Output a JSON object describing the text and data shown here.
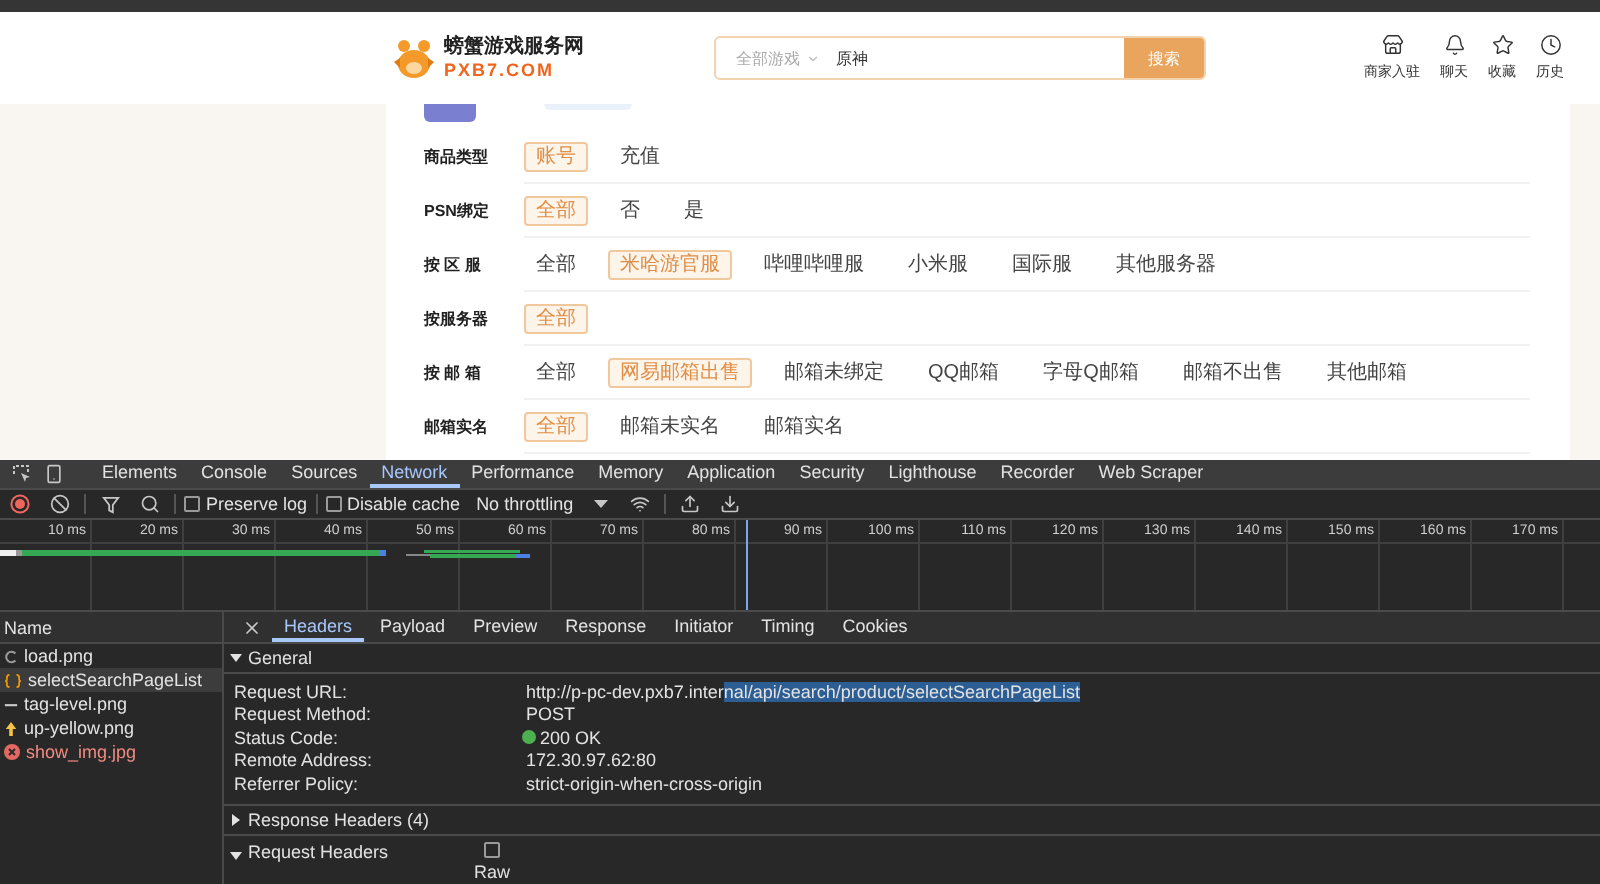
{
  "header": {
    "logo": {
      "title": "螃蟹游戏服务网",
      "domain": "PXB7.COM"
    },
    "search": {
      "category": "全部游戏",
      "value": "原神",
      "button": "搜索"
    },
    "nav": [
      {
        "label": "商家入驻",
        "kind": "store"
      },
      {
        "label": "聊天",
        "kind": "bell"
      },
      {
        "label": "收藏",
        "kind": "star"
      },
      {
        "label": "历史",
        "kind": "clock"
      }
    ]
  },
  "filters": [
    {
      "label": "商品类型",
      "options": [
        {
          "label": "账号",
          "selected": true
        },
        {
          "label": "充值",
          "selected": false
        }
      ]
    },
    {
      "label": "PSN绑定",
      "options": [
        {
          "label": "全部",
          "selected": true
        },
        {
          "label": "否",
          "selected": false
        },
        {
          "label": "是",
          "selected": false
        }
      ]
    },
    {
      "label": "按 区 服",
      "options": [
        {
          "label": "全部",
          "selected": false
        },
        {
          "label": "米哈游官服",
          "selected": true
        },
        {
          "label": "哔哩哔哩服",
          "selected": false
        },
        {
          "label": "小米服",
          "selected": false
        },
        {
          "label": "国际服",
          "selected": false
        },
        {
          "label": "其他服务器",
          "selected": false
        }
      ]
    },
    {
      "label": "按服务器",
      "options": [
        {
          "label": "全部",
          "selected": true
        }
      ]
    },
    {
      "label": "按 邮 箱",
      "options": [
        {
          "label": "全部",
          "selected": false
        },
        {
          "label": "网易邮箱出售",
          "selected": true
        },
        {
          "label": "邮箱未绑定",
          "selected": false
        },
        {
          "label": "QQ邮箱",
          "selected": false
        },
        {
          "label": "字母Q邮箱",
          "selected": false
        },
        {
          "label": "邮箱不出售",
          "selected": false
        },
        {
          "label": "其他邮箱",
          "selected": false
        }
      ]
    },
    {
      "label": "邮箱实名",
      "options": [
        {
          "label": "全部",
          "selected": true
        },
        {
          "label": "邮箱未实名",
          "selected": false
        },
        {
          "label": "邮箱实名",
          "selected": false
        }
      ]
    }
  ],
  "devtools": {
    "tabs": [
      {
        "label": "Elements",
        "selected": false
      },
      {
        "label": "Console",
        "selected": false
      },
      {
        "label": "Sources",
        "selected": false
      },
      {
        "label": "Network",
        "selected": true
      },
      {
        "label": "Performance",
        "selected": false
      },
      {
        "label": "Memory",
        "selected": false
      },
      {
        "label": "Application",
        "selected": false
      },
      {
        "label": "Security",
        "selected": false
      },
      {
        "label": "Lighthouse",
        "selected": false
      },
      {
        "label": "Recorder",
        "selected": false
      },
      {
        "label": "Web Scraper",
        "selected": false
      }
    ],
    "toolbar": {
      "preserve_log": {
        "label": "Preserve log",
        "checked": false
      },
      "disable_cache": {
        "label": "Disable cache",
        "checked": false
      },
      "throttling": "No throttling"
    },
    "timeline_ticks": [
      "10 ms",
      "20 ms",
      "30 ms",
      "40 ms",
      "50 ms",
      "60 ms",
      "70 ms",
      "80 ms",
      "90 ms",
      "100 ms",
      "110 ms",
      "120 ms",
      "130 ms",
      "140 ms",
      "150 ms",
      "160 ms",
      "170 ms"
    ],
    "requests": {
      "column": "Name",
      "items": [
        {
          "name": "load.png",
          "kind": "pending",
          "selected": false
        },
        {
          "name": "selectSearchPageList",
          "kind": "fetch",
          "selected": true
        },
        {
          "name": "tag-level.png",
          "kind": "image",
          "selected": false
        },
        {
          "name": "up-yellow.png",
          "kind": "arrow",
          "selected": false
        },
        {
          "name": "show_img.jpg",
          "kind": "error",
          "selected": false
        }
      ]
    },
    "detail_tabs": [
      {
        "label": "Headers",
        "selected": true
      },
      {
        "label": "Payload",
        "selected": false
      },
      {
        "label": "Preview",
        "selected": false
      },
      {
        "label": "Response",
        "selected": false
      },
      {
        "label": "Initiator",
        "selected": false
      },
      {
        "label": "Timing",
        "selected": false
      },
      {
        "label": "Cookies",
        "selected": false
      }
    ],
    "general": {
      "title": "General",
      "expanded": true,
      "rows": [
        {
          "label": "Request URL:",
          "kind": "url",
          "value_parts": [
            {
              "text": "http://p-pc-dev.pxb7.inter",
              "selected": false
            },
            {
              "text": "nal/api/search/product/selectSearchPageList",
              "selected": true
            }
          ]
        },
        {
          "label": "Request Method:",
          "kind": "text",
          "value_parts": [
            {
              "text": "POST",
              "selected": false
            }
          ]
        },
        {
          "label": "Status Code:",
          "kind": "status",
          "value_parts": [
            {
              "text": "200 OK",
              "selected": false
            }
          ]
        },
        {
          "label": "Remote Address:",
          "kind": "text",
          "value_parts": [
            {
              "text": "172.30.97.62:80",
              "selected": false
            }
          ]
        },
        {
          "label": "Referrer Policy:",
          "kind": "text",
          "value_parts": [
            {
              "text": "strict-origin-when-cross-origin",
              "selected": false
            }
          ]
        }
      ]
    },
    "response_headers": {
      "title": "Response Headers (4)",
      "expanded": false
    },
    "request_headers": {
      "title": "Request Headers",
      "expanded": true,
      "raw": {
        "label": "Raw",
        "checked": false
      }
    }
  }
}
